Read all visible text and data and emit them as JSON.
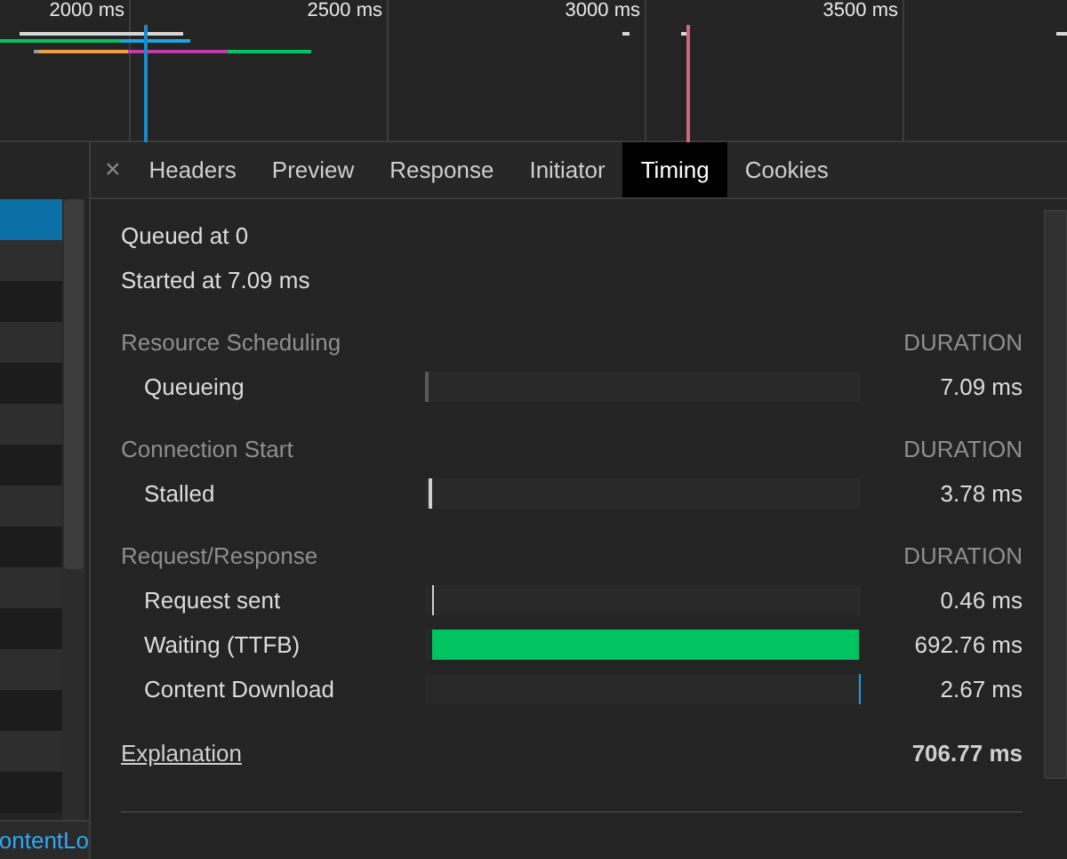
{
  "overview": {
    "ticks": [
      "2000 ms",
      "2500 ms",
      "3000 ms",
      "3500 ms"
    ]
  },
  "request_list": {
    "rows": [
      {
        "selected": true
      },
      {
        "selected": false
      },
      {
        "selected": false
      },
      {
        "selected": false
      },
      {
        "selected": false
      },
      {
        "selected": false
      },
      {
        "selected": false
      },
      {
        "selected": false
      },
      {
        "selected": false
      },
      {
        "selected": false
      },
      {
        "selected": false
      },
      {
        "selected": false
      },
      {
        "selected": false
      },
      {
        "selected": false
      },
      {
        "selected": false
      }
    ],
    "footer_text": "ontentLo"
  },
  "tabs": [
    {
      "label": "Headers",
      "selected": false
    },
    {
      "label": "Preview",
      "selected": false
    },
    {
      "label": "Response",
      "selected": false
    },
    {
      "label": "Initiator",
      "selected": false
    },
    {
      "label": "Timing",
      "selected": true
    },
    {
      "label": "Cookies",
      "selected": false
    }
  ],
  "close_glyph": "×",
  "timing": {
    "queued": "Queued at 0",
    "started": "Started at 7.09 ms",
    "sections": [
      {
        "title": "Resource Scheduling",
        "duration_heading": "DURATION",
        "phases": [
          {
            "name": "Queueing",
            "level": 0.01,
            "color": "#5a5a5a",
            "duration": "7.09 ms"
          }
        ]
      },
      {
        "title": "Connection Start",
        "duration_heading": "DURATION",
        "phases": [
          {
            "name": "Stalled",
            "level": 0.0053,
            "color": "#d0d0d0",
            "duration": "3.78 ms"
          }
        ]
      },
      {
        "title": "Request/Response",
        "duration_heading": "DURATION",
        "phases": [
          {
            "name": "Request sent",
            "level": 0.0007,
            "color": "#d0d0d0",
            "duration": "0.46 ms"
          },
          {
            "name": "Waiting (TTFB)",
            "level": 0.98,
            "color": "#00c462",
            "duration": "692.76 ms"
          },
          {
            "name": "Content Download",
            "level": 0.0038,
            "color": "#0fa0e8",
            "duration": "2.67 ms"
          }
        ]
      }
    ],
    "explanation": "Explanation",
    "total": "706.77 ms"
  }
}
